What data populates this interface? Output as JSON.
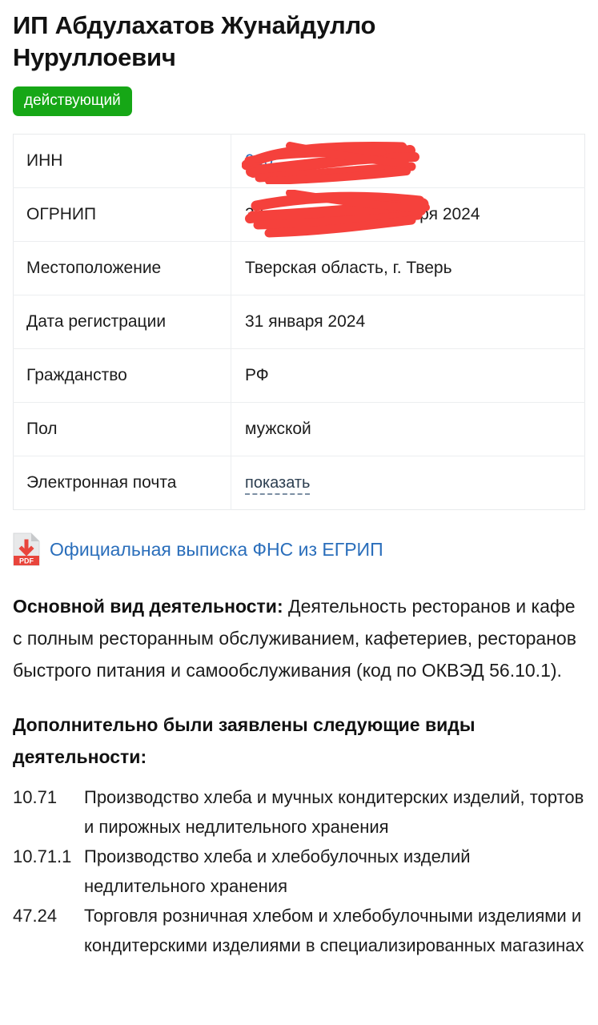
{
  "header": {
    "title": "ИП Абдулахатов Жунайдулло Нуруллоевич",
    "status_badge": "действующий",
    "badge_color": "#16a716"
  },
  "info_table": {
    "rows": [
      {
        "label": "ИНН",
        "value": "",
        "redacted": true,
        "redacted_prefix": "000",
        "redacted_suffix": ""
      },
      {
        "label": "ОГРНИП",
        "value": "",
        "redacted": true,
        "redacted_prefix": "32",
        "redacted_suffix": "13 от 31 января 2024"
      },
      {
        "label": "Местоположение",
        "value": "Тверская область, г. Тверь",
        "redacted": false
      },
      {
        "label": "Дата регистрации",
        "value": "31 января 2024",
        "redacted": false
      },
      {
        "label": "Гражданство",
        "value": "РФ",
        "redacted": false
      },
      {
        "label": "Пол",
        "value": "мужской",
        "redacted": false
      },
      {
        "label": "Электронная почта",
        "value": "показать",
        "redacted": false,
        "is_toggle_link": true
      }
    ]
  },
  "pdf_link": {
    "label": "Официальная выписка ФНС из ЕГРИП",
    "icon": "pdf-file-download-icon",
    "icon_badge": "PDF",
    "link_color": "#2a6ebb"
  },
  "main_activity": {
    "label": "Основной вид деятельности:",
    "text": " Деятельность ресторанов и кафе с полным ресторанным обслуживанием, кафетериев, ресторанов быстрого питания и самообслуживания (код по ОКВЭД 56.10.1)."
  },
  "extra_activities": {
    "heading": "Дополнительно были заявлены следующие виды деятельности:",
    "items": [
      {
        "code": "10.71",
        "name": "Производство хлеба и мучных кондитерских изделий, тортов и пирожных недлительного хранения"
      },
      {
        "code": "10.71.1",
        "name": "Производство хлеба и хлебобулочных изделий недлительного хранения"
      },
      {
        "code": "47.24",
        "name": "Торговля розничная хлебом и хлебобулочными изделиями и кондитерскими изделиями в специализированных магазинах"
      }
    ]
  },
  "redaction": {
    "color": "#f5413c",
    "note": "hand-drawn red scribble covering identifiers"
  }
}
